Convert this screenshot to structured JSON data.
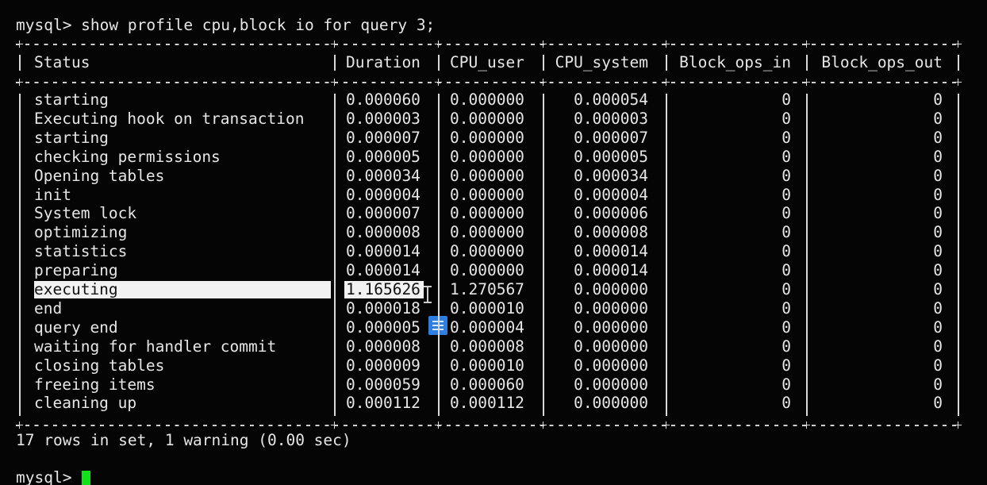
{
  "command": "mysql> show profile cpu,block io for query 3;",
  "columns": [
    "Status",
    "Duration",
    "CPU_user",
    "CPU_system",
    "Block_ops_in",
    "Block_ops_out"
  ],
  "rows": [
    [
      "starting",
      "0.000060",
      "0.000000",
      "0.000054",
      "0",
      "0"
    ],
    [
      "Executing hook on transaction",
      "0.000003",
      "0.000000",
      "0.000003",
      "0",
      "0"
    ],
    [
      "starting",
      "0.000007",
      "0.000000",
      "0.000007",
      "0",
      "0"
    ],
    [
      "checking permissions",
      "0.000005",
      "0.000000",
      "0.000005",
      "0",
      "0"
    ],
    [
      "Opening tables",
      "0.000034",
      "0.000000",
      "0.000034",
      "0",
      "0"
    ],
    [
      "init",
      "0.000004",
      "0.000000",
      "0.000004",
      "0",
      "0"
    ],
    [
      "System lock",
      "0.000007",
      "0.000000",
      "0.000006",
      "0",
      "0"
    ],
    [
      "optimizing",
      "0.000008",
      "0.000000",
      "0.000008",
      "0",
      "0"
    ],
    [
      "statistics",
      "0.000014",
      "0.000000",
      "0.000014",
      "0",
      "0"
    ],
    [
      "preparing",
      "0.000014",
      "0.000000",
      "0.000014",
      "0",
      "0"
    ],
    [
      "executing",
      "1.165626",
      "1.270567",
      "0.000000",
      "0",
      "0"
    ],
    [
      "end",
      "0.000018",
      "0.000010",
      "0.000000",
      "0",
      "0"
    ],
    [
      "query end",
      "0.000005",
      "0.000004",
      "0.000000",
      "0",
      "0"
    ],
    [
      "waiting for handler commit",
      "0.000008",
      "0.000008",
      "0.000000",
      "0",
      "0"
    ],
    [
      "closing tables",
      "0.000009",
      "0.000010",
      "0.000000",
      "0",
      "0"
    ],
    [
      "freeing items",
      "0.000059",
      "0.000060",
      "0.000000",
      "0",
      "0"
    ],
    [
      "cleaning up",
      "0.000112",
      "0.000112",
      "0.000000",
      "0",
      "0"
    ]
  ],
  "summary": "17 rows in set, 1 warning (0.00 sec)",
  "prompt": "mysql>",
  "highlighted_row_index": 10,
  "icons": [
    "text-cursor-icon",
    "document-icon"
  ],
  "colors": {
    "background": "#050505",
    "text": "#e6e6e6",
    "selection": "#f2f2f2",
    "cursor": "#12e01a",
    "doc_icon": "#2f7fe2"
  }
}
